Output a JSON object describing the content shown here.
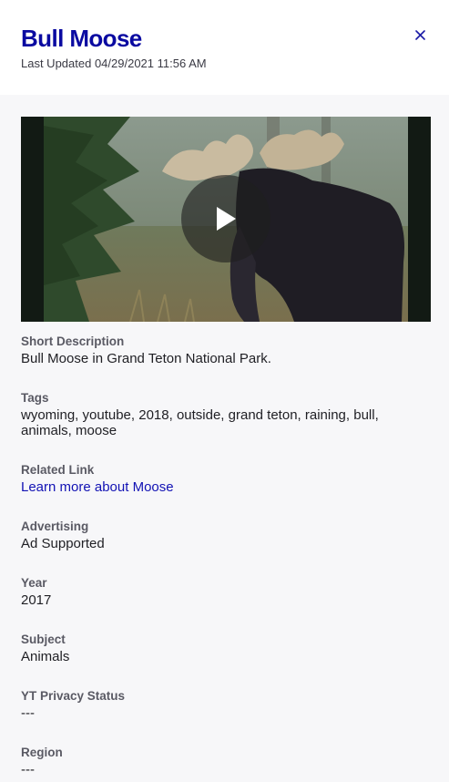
{
  "header": {
    "title": "Bull Moose",
    "last_updated": "Last Updated 04/29/2021 11:56 AM",
    "close_icon": "close-icon"
  },
  "video": {
    "play_icon": "play-icon"
  },
  "fields": {
    "short_description": {
      "label": "Short Description",
      "value": "Bull Moose in Grand Teton National Park."
    },
    "tags": {
      "label": "Tags",
      "line1": "wyoming, youtube, 2018, outside, grand teton, raining, bull,",
      "line2": "animals, moose"
    },
    "related_link": {
      "label": "Related Link",
      "value": "Learn more about Moose"
    },
    "advertising": {
      "label": "Advertising",
      "value": "Ad Supported"
    },
    "year": {
      "label": "Year",
      "value": "2017"
    },
    "subject": {
      "label": "Subject",
      "value": "Animals"
    },
    "yt_privacy_status": {
      "label": "YT Privacy Status",
      "value": "---"
    },
    "region": {
      "label": "Region",
      "value": "---"
    }
  },
  "colors": {
    "title": "#0a0aa1",
    "link": "#1212b4",
    "panel_bg": "#f7f7f9"
  }
}
